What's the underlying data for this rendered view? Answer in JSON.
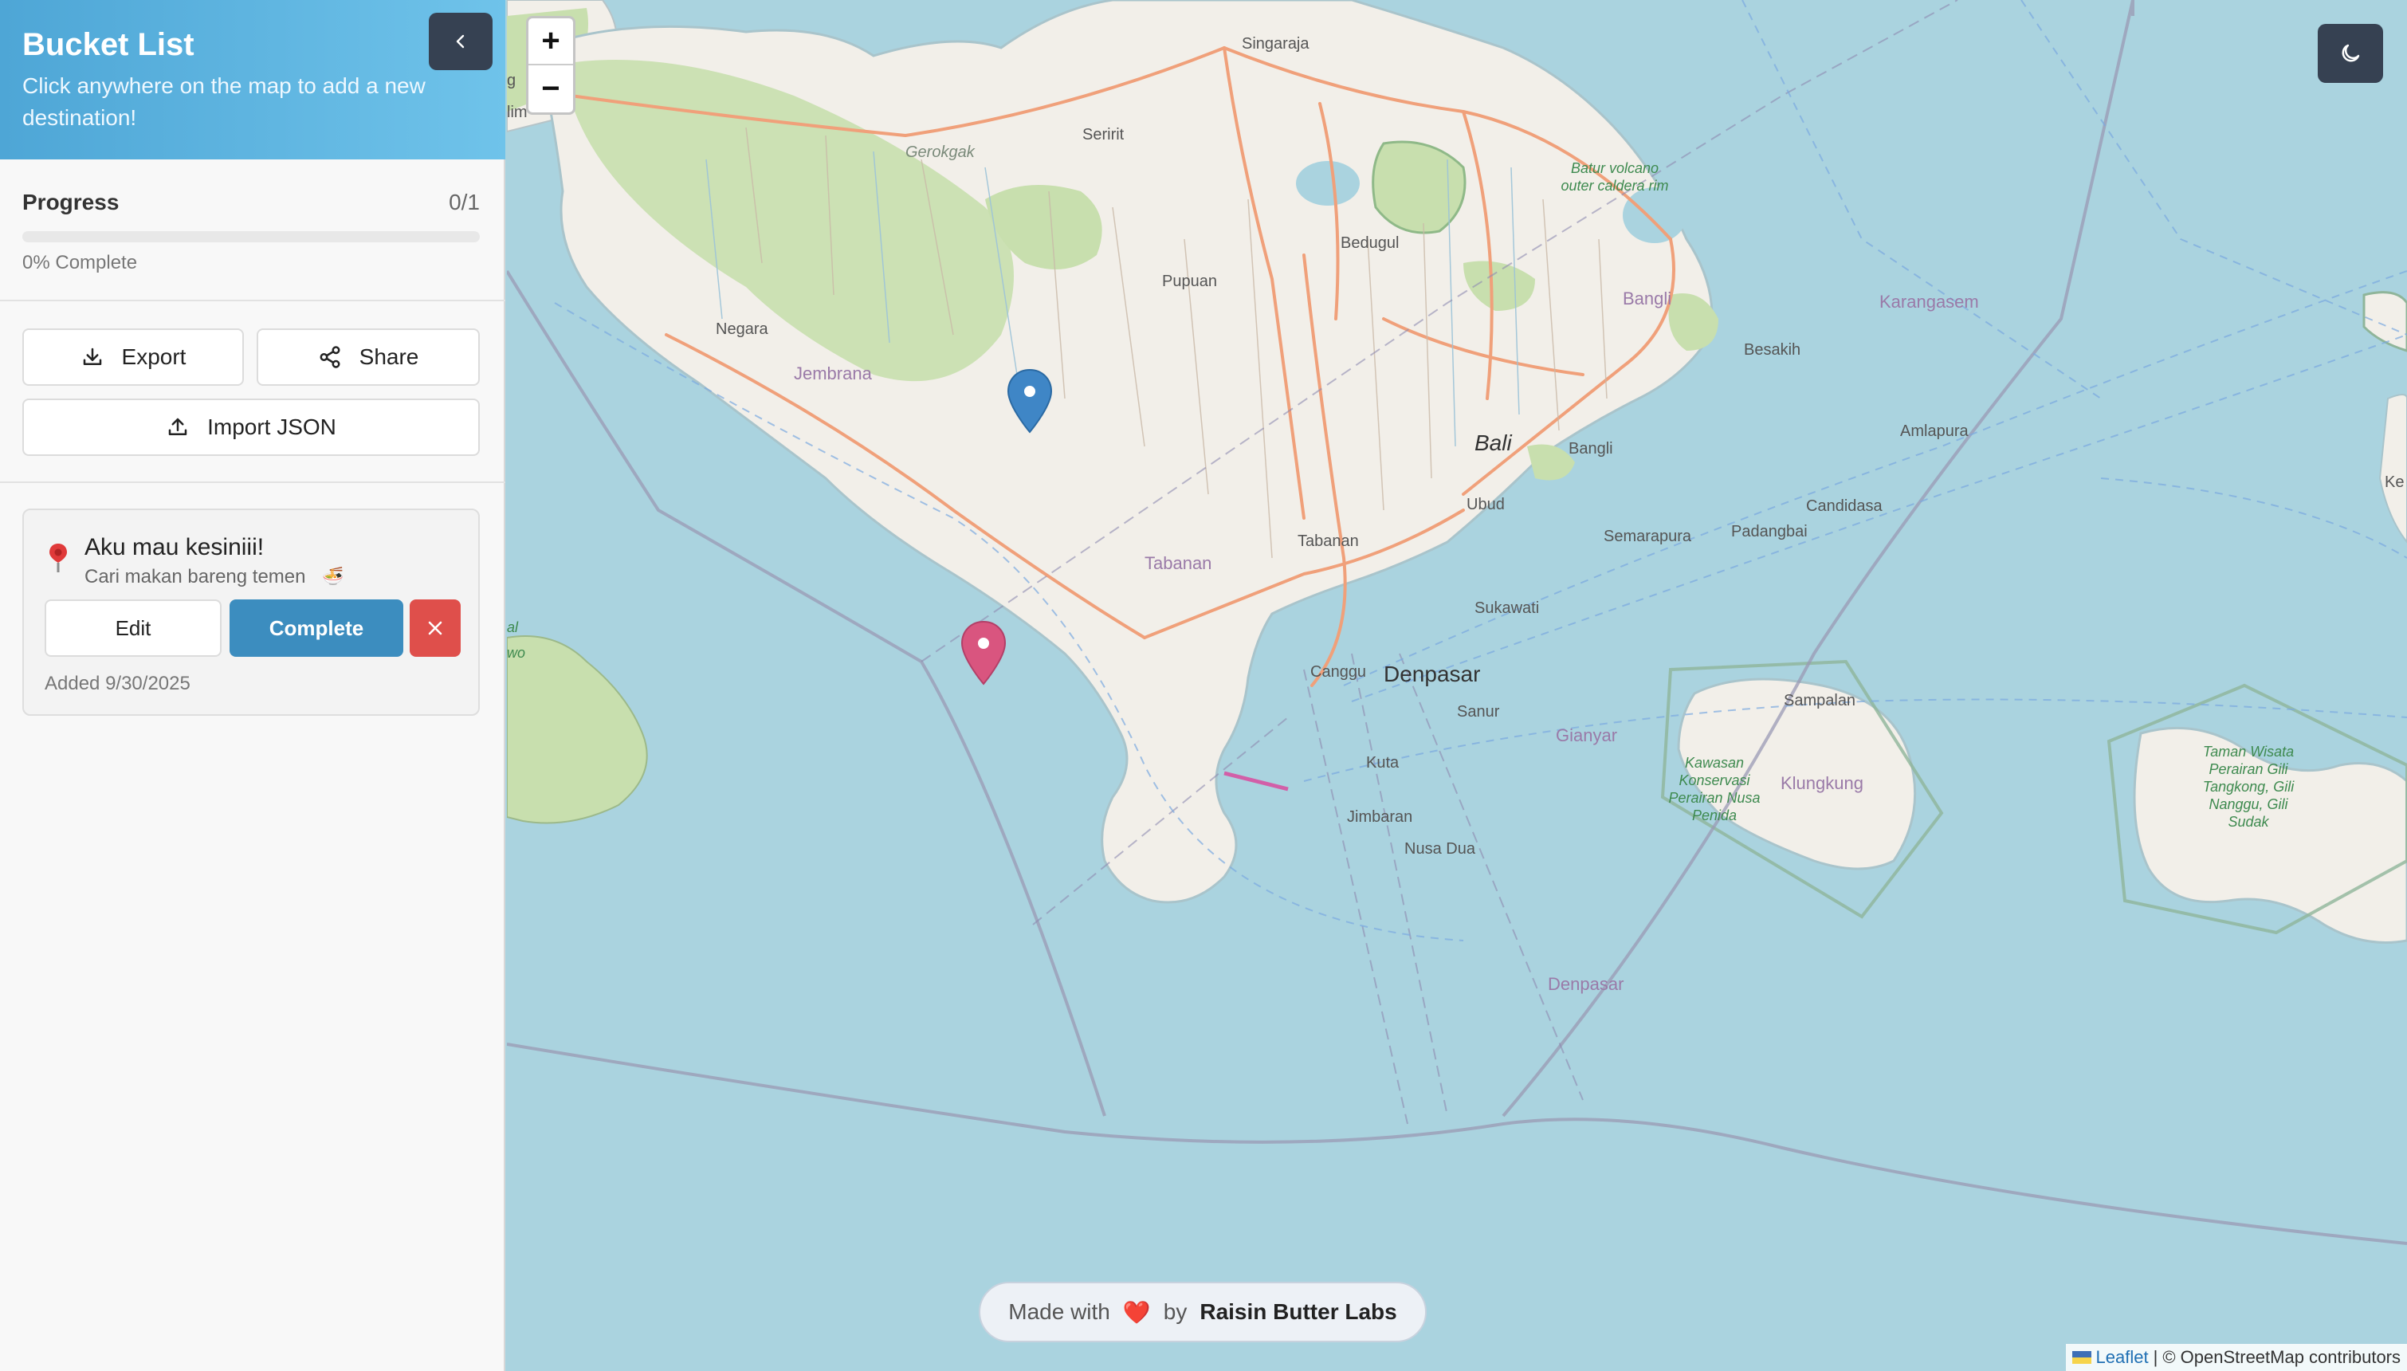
{
  "sidebar": {
    "title": "Bucket List",
    "subtitle": "Click anywhere on the map to add a new destination!",
    "collapse_icon": "chevron-left-icon",
    "progress": {
      "label": "Progress",
      "count": "0/1",
      "fraction": 0,
      "percent_text": "0% Complete"
    },
    "actions": {
      "export_label": "Export",
      "share_label": "Share",
      "import_label": "Import JSON"
    },
    "destinations": [
      {
        "title": "Aku mau kesiniii!",
        "description": "Cari makan bareng temen",
        "description_emoji": "🍜",
        "edit_label": "Edit",
        "complete_label": "Complete",
        "delete_icon": "close-icon",
        "added": "Added 9/30/2025"
      }
    ]
  },
  "map": {
    "zoom_in": "+",
    "zoom_out": "−",
    "theme_icon": "moon-icon",
    "credit": {
      "prefix": "Made with",
      "heart": "❤️",
      "by": "by",
      "brand": "Raisin Butter Labs"
    },
    "attribution": {
      "leaflet": "Leaflet",
      "separator": "|",
      "osm": "© OpenStreetMap contributors"
    },
    "labels": {
      "singaraja": "Singaraja",
      "seririt": "Seririt",
      "gerokgak": "Gerokgak",
      "bedugul": "Bedugul",
      "pupuan": "Pupuan",
      "negara": "Negara",
      "jembrana": "Jembrana",
      "batur": "Batur volcano outer caldera rim",
      "bangli_region": "Bangli",
      "karangasem": "Karangasem",
      "besakih": "Besakih",
      "bali": "Bali",
      "bangli_town": "Bangli",
      "amlapura": "Amlapura",
      "ubud": "Ubud",
      "candidasa": "Candidasa",
      "tabanan_town": "Tabanan",
      "semarapura": "Semarapura",
      "padangbai": "Padangbai",
      "tabanan_region": "Tabanan",
      "sukawati": "Sukawati",
      "canggu": "Canggu",
      "denpasar": "Denpasar",
      "sanur": "Sanur",
      "gianyar": "Gianyar",
      "sampalan": "Sampalan",
      "kawasan": "Kawasan Konservasi Perairan Nusa Penida",
      "klungkung": "Klungkung",
      "kuta": "Kuta",
      "jimbaran": "Jimbaran",
      "nusa_dua": "Nusa Dua",
      "denpasar_sea": "Denpasar",
      "taman": "Taman Wisata Perairan Gili Tangkong, Gili Nanggu, Gili Sudak",
      "left_edge_1": "g",
      "left_edge_2": "lim",
      "left_edge_3": "al",
      "left_edge_4": "wo",
      "right_edge_1": "Ke"
    },
    "markers": [
      {
        "name": "Aku mau kesiniii!",
        "color": "#3f86c6"
      },
      {
        "name": "selected",
        "color": "#d9557f"
      }
    ]
  },
  "colors": {
    "header_start": "#4ea6d6",
    "header_end": "#6fc3ea",
    "dark_button": "#364152",
    "complete_button": "#3c8dbf",
    "delete_button": "#df4f4b",
    "sea": "#aad3df",
    "land": "#f2efe9",
    "forest": "#c8dfae"
  }
}
